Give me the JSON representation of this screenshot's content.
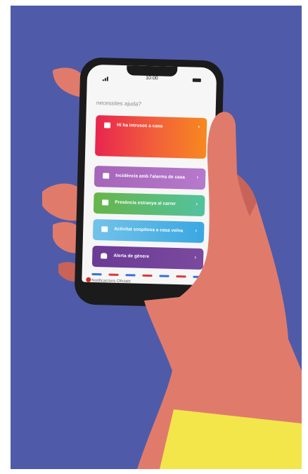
{
  "status_bar": {
    "time": "10:00"
  },
  "screen": {
    "heading": "necessites ajuda?",
    "cards": [
      {
        "label": "Hi ha intrusos a casa",
        "icon": "house-icon",
        "color": "#e8254f"
      },
      {
        "label": "Incidència amb l'alarma de casa",
        "icon": "house-icon",
        "color": "#a565b9"
      },
      {
        "label": "Presència estranya al carrer",
        "icon": "house-icon",
        "color": "#66b548"
      },
      {
        "label": "Activitat sospitosa a casa veïna",
        "icon": "house-icon",
        "color": "#3aa7e1"
      },
      {
        "label": "Alerta de gènere",
        "icon": "hand-icon",
        "color": "#6b3a96"
      }
    ],
    "footer_item": "Notificacions Oficials"
  },
  "colors": {
    "background": "#4f5ba8",
    "skin": "#e07b6c",
    "sleeve": "#f3e64b"
  }
}
